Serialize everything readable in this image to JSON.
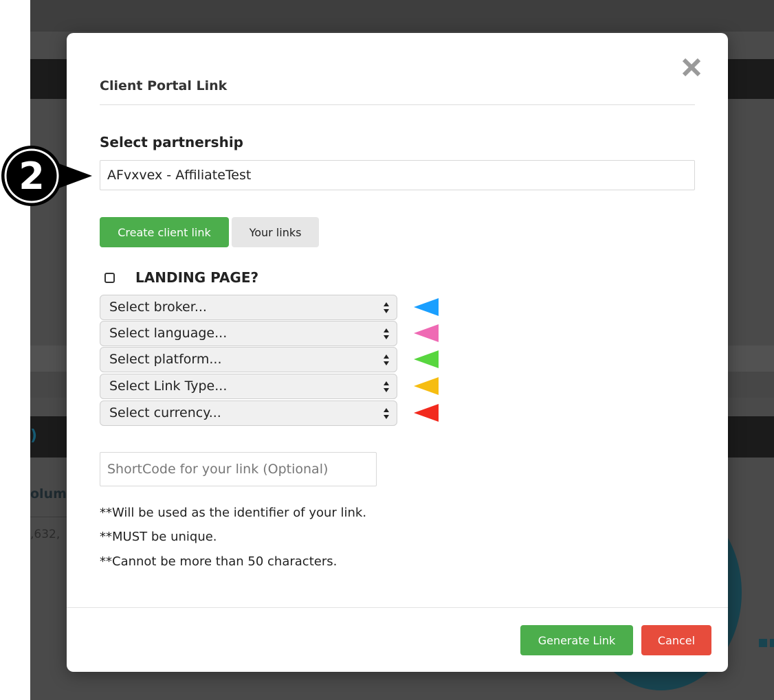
{
  "background": {
    "heading_fragment": "olum",
    "value_fragment": ",632,"
  },
  "modal": {
    "title": "Client Portal Link",
    "close_icon": "close-icon",
    "partnership_label": "Select partnership",
    "partnership_value": "AFvxvex - AffiliateTest",
    "buttons": {
      "create_client_link": "Create client link",
      "your_links": "Your links"
    },
    "landing_page_label": "LANDING PAGE?",
    "landing_page_checked": false,
    "selects": [
      {
        "label": "Select broker...",
        "pointer_color": "#1a9fff"
      },
      {
        "label": "Select language...",
        "pointer_color": "#ef6ab4"
      },
      {
        "label": "Select platform...",
        "pointer_color": "#58d63f"
      },
      {
        "label": "Select Link Type...",
        "pointer_color": "#f6bd11"
      },
      {
        "label": "Select currency...",
        "pointer_color": "#f22a1e"
      }
    ],
    "shortcode_placeholder": "ShortCode for your link (Optional)",
    "notes": [
      "**Will be used as the identifier of your link.",
      "**MUST be unique.",
      "**Cannot be more than 50 characters."
    ],
    "footer": {
      "generate": "Generate Link",
      "cancel": "Cancel"
    }
  },
  "annotation": {
    "step_number": "2"
  },
  "colors": {
    "success": "#4cae4c",
    "danger": "#e74c3c",
    "overlay": "#4a4a4a"
  }
}
